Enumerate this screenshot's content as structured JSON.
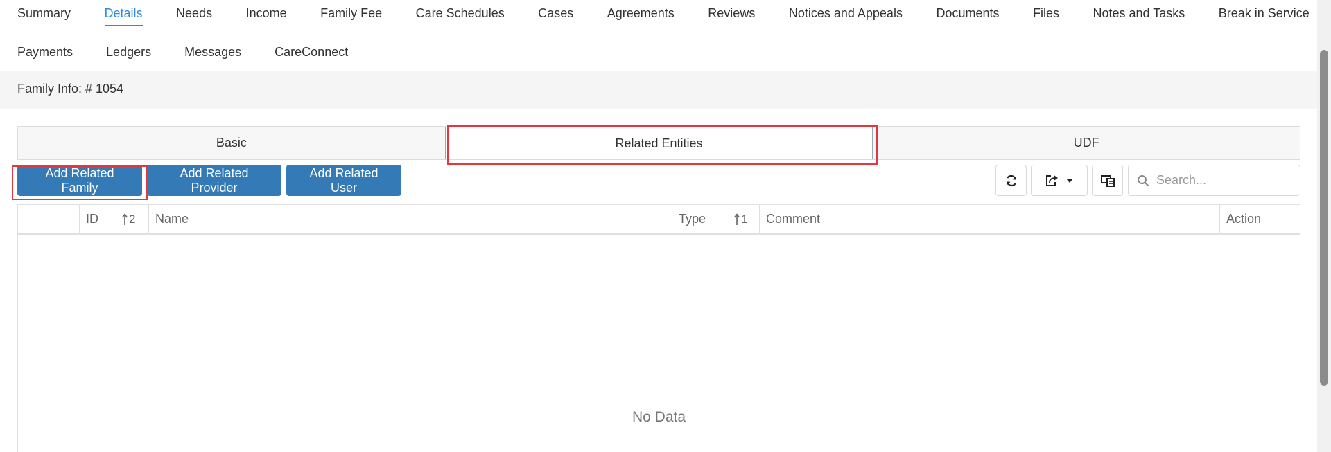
{
  "nav": {
    "row1": [
      "Summary",
      "Details",
      "Needs",
      "Income",
      "Family Fee",
      "Care Schedules",
      "Cases",
      "Agreements",
      "Reviews",
      "Notices and Appeals",
      "Documents",
      "Files",
      "Notes and Tasks",
      "Break in Service"
    ],
    "row2": [
      "Payments",
      "Ledgers",
      "Messages",
      "CareConnect"
    ],
    "active": "Details"
  },
  "info_bar": {
    "text": "Family Info: # 1054"
  },
  "subtabs": {
    "basic": "Basic",
    "related": "Related Entities",
    "udf": "UDF",
    "active": "Related Entities"
  },
  "actions": {
    "add_family": "Add Related Family",
    "add_provider": "Add Related Provider",
    "add_user": "Add Related User"
  },
  "toolbar": {
    "refresh_icon": "refresh-icon",
    "export_icon": "export-icon",
    "columns_icon": "columns-icon",
    "search_placeholder": "Search..."
  },
  "table": {
    "columns": {
      "id": "ID",
      "id_sort": "2",
      "name": "Name",
      "type": "Type",
      "type_sort": "1",
      "comment": "Comment",
      "action": "Action"
    },
    "empty_text": "No Data"
  },
  "colors": {
    "accent": "#2f8ae0",
    "button": "#337ab7",
    "highlight": "#e0383e"
  }
}
